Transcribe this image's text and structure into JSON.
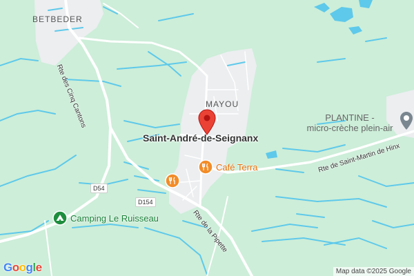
{
  "map": {
    "labels": {
      "betbeder": "BETBEDER",
      "mayou": "MAYOU",
      "town": "Saint-André-de-Seignanx",
      "plantine_line1": "PLANTINE -",
      "plantine_line2": "micro-crèche plein-air",
      "cafe": "Café Terra",
      "camping": "Camping Le Ruisseau"
    },
    "roads": {
      "cinq_cantons": "Rte des Cinq Cantons",
      "pipette": "Rte de la Pipette",
      "saint_martin": "Rte de Saint-Martin de Hinx",
      "d54": "D54",
      "d154": "D154"
    },
    "attribution": "Map data ©2025 Google",
    "logo": {
      "letters": [
        "G",
        "o",
        "o",
        "g",
        "l",
        "e"
      ],
      "colors": [
        "#4285F4",
        "#EA4335",
        "#FBBC05",
        "#4285F4",
        "#34A853",
        "#EA4335"
      ]
    },
    "colors": {
      "land": "#cdeed9",
      "urban": "#eceef0",
      "water": "#5ec9ea",
      "road": "#ffffff",
      "marker": "#ea4335",
      "food": "#f28c28",
      "park": "#1e8e3e"
    },
    "icons": {
      "marker": "red-pin-icon",
      "restaurant": "fork-knife-icon",
      "camping": "tent-icon",
      "plantine": "gray-pin-icon"
    }
  }
}
